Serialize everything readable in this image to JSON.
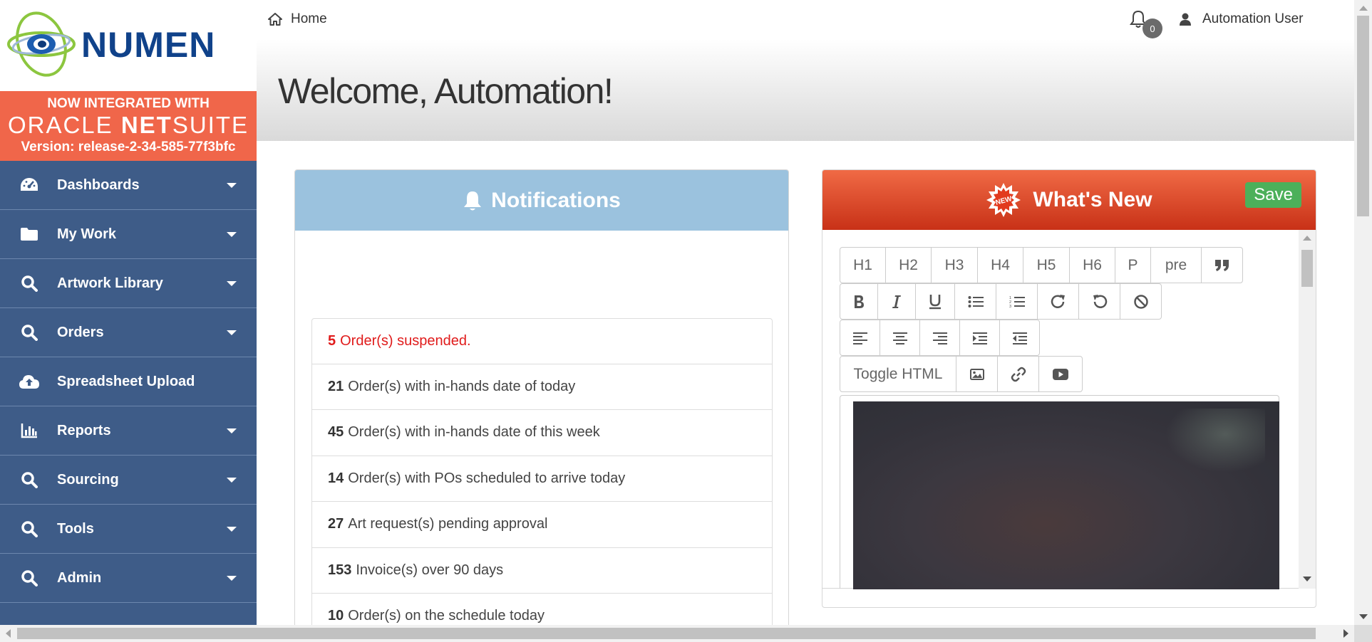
{
  "brand": {
    "logo_text": "NUMEN",
    "banner_line1": "NOW INTEGRATED WITH",
    "banner_oracle": "ORACLE",
    "banner_netsuite_bold": "NET",
    "banner_netsuite_light": "SUITE",
    "version": "Version: release-2-34-585-77f3bfc"
  },
  "sidebar": {
    "items": [
      {
        "label": "Dashboards",
        "icon": "tachometer-icon",
        "has_caret": true
      },
      {
        "label": "My Work",
        "icon": "folder-icon",
        "has_caret": true
      },
      {
        "label": "Artwork Library",
        "icon": "search-icon",
        "has_caret": true
      },
      {
        "label": "Orders",
        "icon": "search-icon",
        "has_caret": true
      },
      {
        "label": "Spreadsheet Upload",
        "icon": "cloud-upload-icon",
        "has_caret": false
      },
      {
        "label": "Reports",
        "icon": "bar-chart-icon",
        "has_caret": true
      },
      {
        "label": "Sourcing",
        "icon": "search-icon",
        "has_caret": true
      },
      {
        "label": "Tools",
        "icon": "search-icon",
        "has_caret": true
      },
      {
        "label": "Admin",
        "icon": "search-icon",
        "has_caret": true
      }
    ]
  },
  "topbar": {
    "home_label": "Home",
    "notification_count": "0",
    "user_name": "Automation User"
  },
  "welcome": {
    "title": "Welcome, Automation!"
  },
  "notifications": {
    "title": "Notifications",
    "items": [
      {
        "count": "5",
        "text": "Order(s) suspended.",
        "alert": true
      },
      {
        "count": "21",
        "text": "Order(s) with in-hands date of today",
        "alert": false
      },
      {
        "count": "45",
        "text": "Order(s) with in-hands date of this week",
        "alert": false
      },
      {
        "count": "14",
        "text": "Order(s) with POs scheduled to arrive today",
        "alert": false
      },
      {
        "count": "27",
        "text": "Art request(s) pending approval",
        "alert": false
      },
      {
        "count": "153",
        "text": "Invoice(s) over 90 days",
        "alert": false
      },
      {
        "count": "10",
        "text": "Order(s) on the schedule today",
        "alert": false
      }
    ]
  },
  "whats_new": {
    "title": "What's New",
    "badge_text": "NEW",
    "save_label": "Save",
    "toolbar": {
      "headings": [
        "H1",
        "H2",
        "H3",
        "H4",
        "H5",
        "H6",
        "P",
        "pre"
      ],
      "toggle_html": "Toggle HTML"
    }
  },
  "colors": {
    "sidebar_bg": "#3e5c88",
    "oracle_banner": "#f0664a",
    "notifications_header": "#9bc2de",
    "whats_new_header": "#d84525",
    "save_button": "#4cb05a",
    "alert_text": "#e01b1b"
  }
}
